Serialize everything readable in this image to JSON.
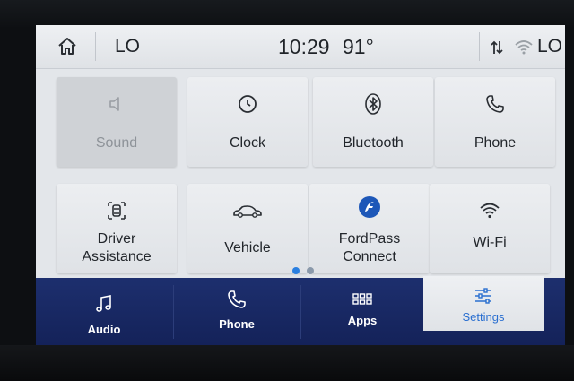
{
  "status_bar": {
    "temp_left": "LO",
    "time": "10:29",
    "outside_temp": "91°",
    "temp_right": "LO"
  },
  "tiles": [
    {
      "label": "Sound",
      "icon": "speaker-icon",
      "enabled": false
    },
    {
      "label": "Clock",
      "icon": "clock-icon",
      "enabled": true
    },
    {
      "label": "Bluetooth",
      "icon": "bluetooth-icon",
      "enabled": true
    },
    {
      "label": "Phone",
      "icon": "phone-icon",
      "enabled": true
    },
    {
      "label_line1": "Driver",
      "label_line2": "Assistance",
      "icon": "driver-assistance-icon",
      "enabled": true
    },
    {
      "label": "Vehicle",
      "icon": "car-icon",
      "enabled": true
    },
    {
      "label_line1": "FordPass",
      "label_line2": "Connect",
      "icon": "fordpass-icon",
      "enabled": true
    },
    {
      "label": "Wi-Fi",
      "icon": "wifi-icon",
      "enabled": true
    }
  ],
  "pagination": {
    "pages": 2,
    "current": 1
  },
  "nav": [
    {
      "label": "Audio",
      "icon": "music-note-icon",
      "selected": false
    },
    {
      "label": "Phone",
      "icon": "phone-icon",
      "selected": false
    },
    {
      "label": "Apps",
      "icon": "apps-grid-icon",
      "selected": false
    },
    {
      "label": "Settings",
      "icon": "sliders-icon",
      "selected": true
    }
  ],
  "colors": {
    "accent": "#2a7fe0",
    "nav_background": "#1a2a66",
    "selected_label": "#2a6fd0"
  }
}
